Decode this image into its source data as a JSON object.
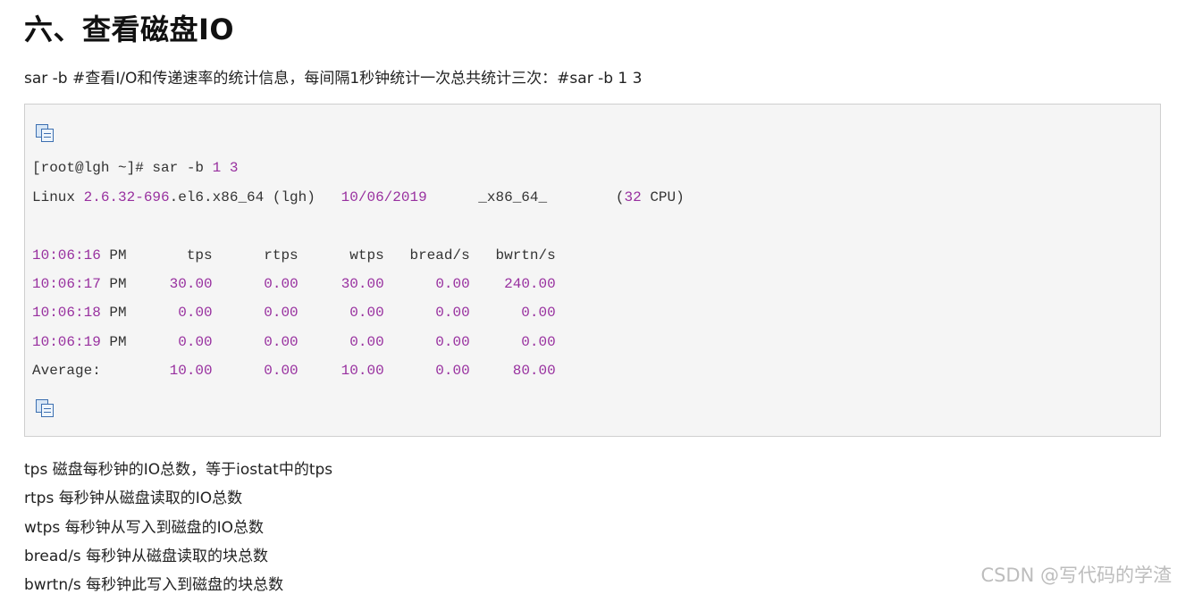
{
  "heading": "六、查看磁盘IO",
  "intro": "sar -b #查看I/O和传递速率的统计信息，每间隔1秒钟统计一次总共统计三次：#sar -b 1 3",
  "code": {
    "prompt": "[root@lgh ~]# sar -b ",
    "args": "1 3",
    "sys": {
      "os": "Linux ",
      "kernel_num": "2.6.32-696",
      "kernel_rest": ".el6.x86_64 (lgh)   ",
      "date": "10/06/2019",
      "arch": "      _x86_64_        (",
      "cpus": "32",
      "cpu_label": " CPU)"
    },
    "header": {
      "time": "10:06:16",
      "ampm": " PM       tps      rtps      wtps   bread/s   bwrtn/s"
    },
    "rows": [
      {
        "time": "10:06:17",
        "ampm": " PM",
        "tps": "30.00",
        "rtps": "0.00",
        "wtps": "30.00",
        "bread": "0.00",
        "bwrtn": "240.00"
      },
      {
        "time": "10:06:18",
        "ampm": " PM",
        "tps": "0.00",
        "rtps": "0.00",
        "wtps": "0.00",
        "bread": "0.00",
        "bwrtn": "0.00"
      },
      {
        "time": "10:06:19",
        "ampm": " PM",
        "tps": "0.00",
        "rtps": "0.00",
        "wtps": "0.00",
        "bread": "0.00",
        "bwrtn": "0.00"
      }
    ],
    "average": {
      "label": "Average:",
      "tps": "10.00",
      "rtps": "0.00",
      "wtps": "10.00",
      "bread": "0.00",
      "bwrtn": "80.00"
    }
  },
  "definitions": [
    "tps 磁盘每秒钟的IO总数，等于iostat中的tps",
    "rtps 每秒钟从磁盘读取的IO总数",
    "wtps 每秒钟从写入到磁盘的IO总数",
    "bread/s 每秒钟从磁盘读取的块总数",
    "bwrtn/s 每秒钟此写入到磁盘的块总数"
  ],
  "watermark": "CSDN @写代码的学渣",
  "icons": {
    "copy": "copy-code-icon"
  },
  "colors": {
    "number": "#98309f",
    "code_bg": "#f5f5f5",
    "border": "#cfcfcf"
  }
}
